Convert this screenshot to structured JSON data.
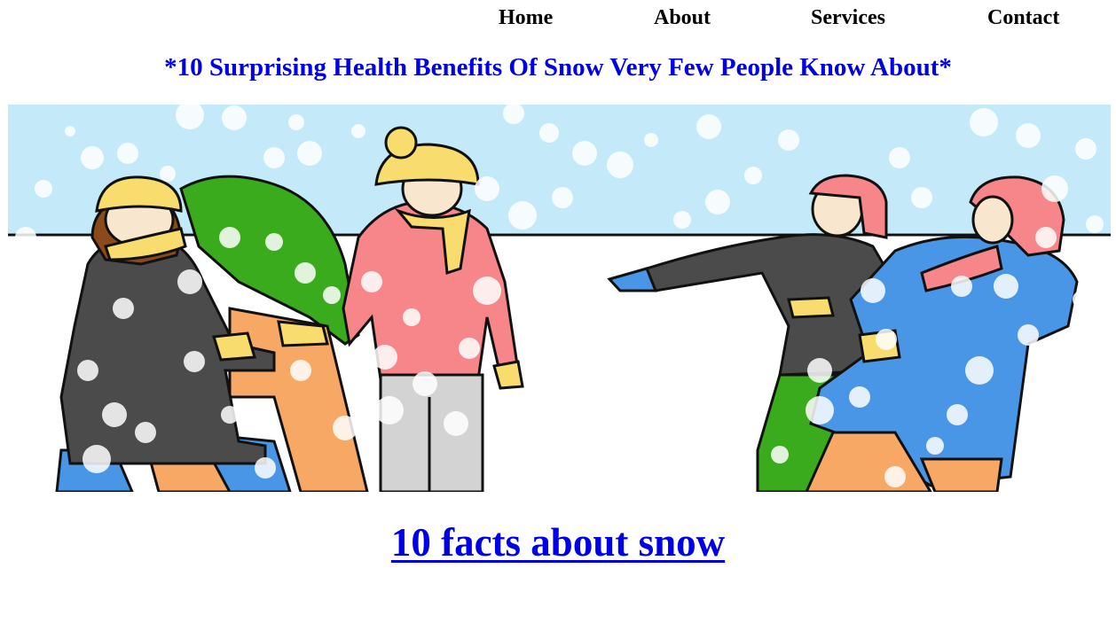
{
  "nav": {
    "items": [
      {
        "label": "Home"
      },
      {
        "label": "About"
      },
      {
        "label": "Services"
      },
      {
        "label": "Contact"
      }
    ]
  },
  "headline": "*10 Surprising Health Benefits Of Snow Very Few People Know About*",
  "facts_link": "10 facts about snow",
  "colors": {
    "headline": "#0000e6",
    "link": "#0000e6",
    "nav_text": "#000000",
    "sky": "#c4e9f8"
  }
}
